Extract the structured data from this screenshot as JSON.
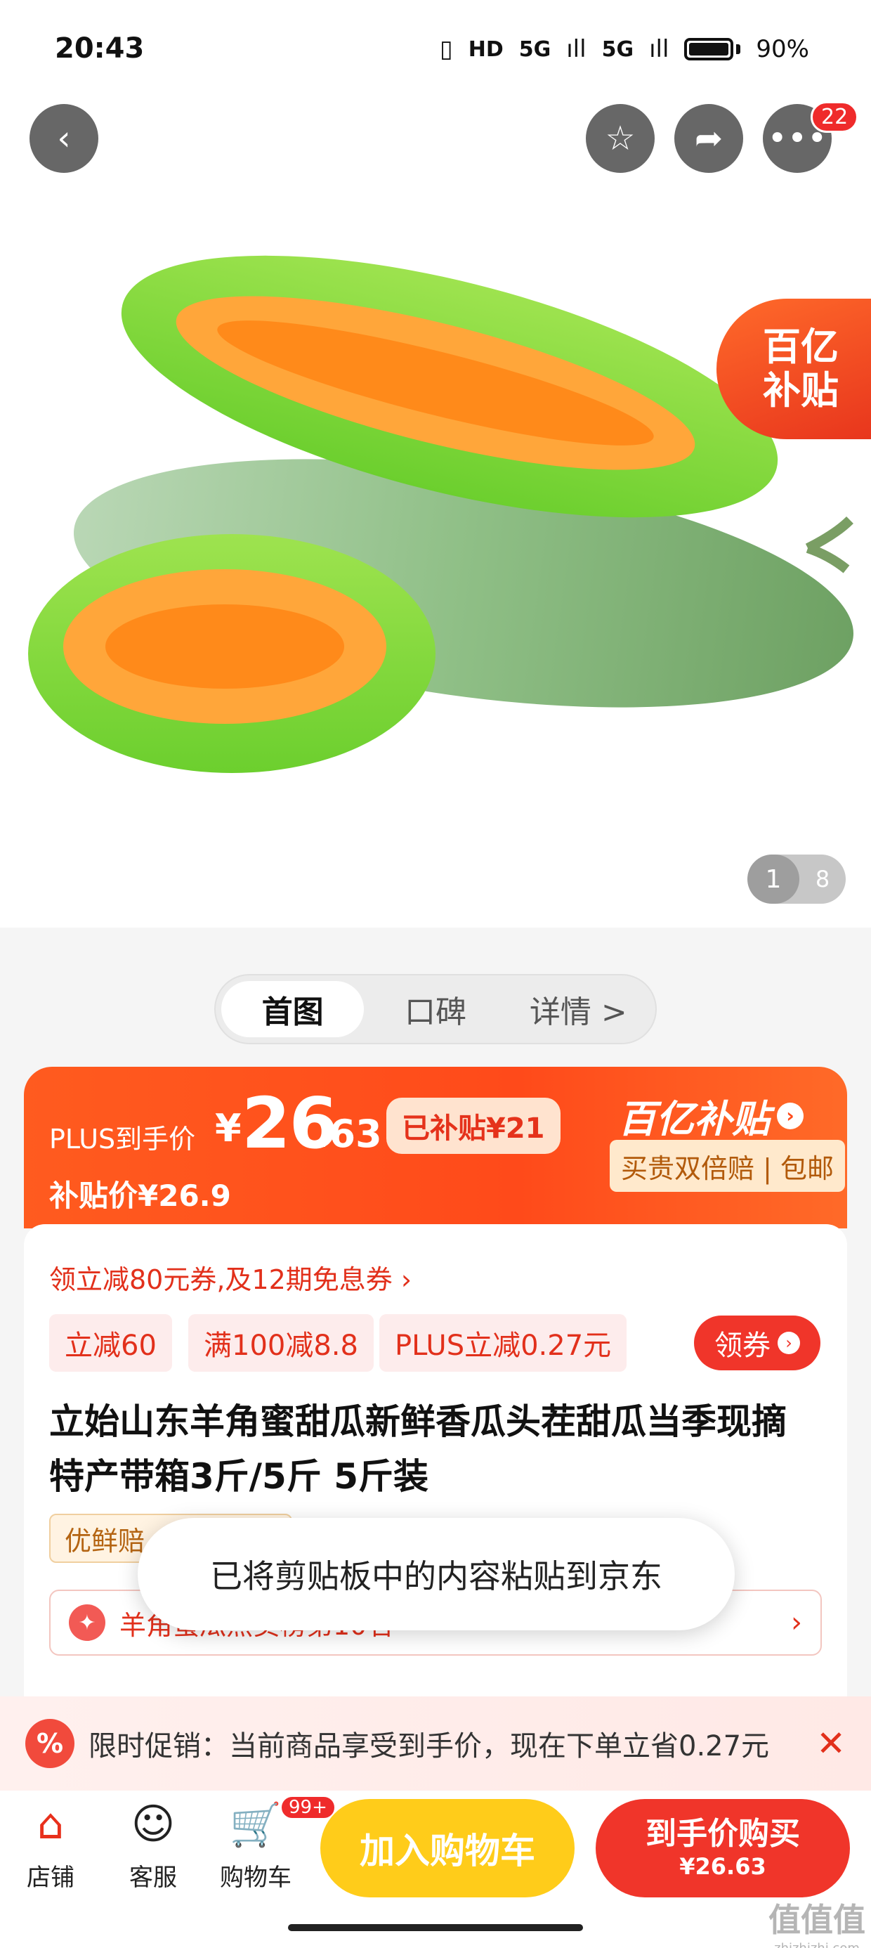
{
  "status_bar": {
    "time": "20:43",
    "network_1": "HD",
    "network_2": "5G",
    "network_3": "5G",
    "battery": "90%"
  },
  "top_nav": {
    "cart_count": "22"
  },
  "hero": {
    "subsidy_line1": "百亿",
    "subsidy_line2": "补贴",
    "page_current": "1",
    "page_total": "8"
  },
  "tabs": [
    {
      "label": "首图"
    },
    {
      "label": "口碑"
    },
    {
      "label": "详情 >"
    }
  ],
  "price": {
    "plus_label": "PLUS到手价",
    "symbol": "¥",
    "integer": "26",
    "decimal": ".63",
    "subsidized": "已补贴¥21",
    "subsidy_price": "补贴价¥26.9",
    "brand": "百亿补贴",
    "guarantee": "买贵双倍赔 | 包邮"
  },
  "coupons": {
    "line": "领立减80元券,及12期免息券 ›",
    "tags": [
      "立减60",
      "满100减8.8",
      "PLUS立减0.27元"
    ],
    "get_label": "领券"
  },
  "product": {
    "title": "立始山东羊角蜜甜瓜新鲜香瓜头茬甜瓜当季现摘特产带箱3斤/5斤 5斤装",
    "fresh_tag": "优鲜赔 · 足斤足两",
    "rank": "羊角蜜瓜热卖榜第10名"
  },
  "toast": "已将剪贴板中的内容粘贴到京东",
  "promo": {
    "text": "限时促销：当前商品享受到手价，现在下单立省0.27元"
  },
  "bottom": {
    "store": "店铺",
    "service": "客服",
    "cart": "购物车",
    "cart_badge": "99+",
    "add_cart": "加入购物车",
    "buy_line1": "到手价购买",
    "buy_line2": "¥26.63"
  },
  "watermark": {
    "main": "值值值",
    "sub": "zhizhizhi.com"
  },
  "colors": {
    "accent_red": "#f0352a",
    "orange": "#ff4a1a",
    "yellow": "#ffcc1a"
  }
}
